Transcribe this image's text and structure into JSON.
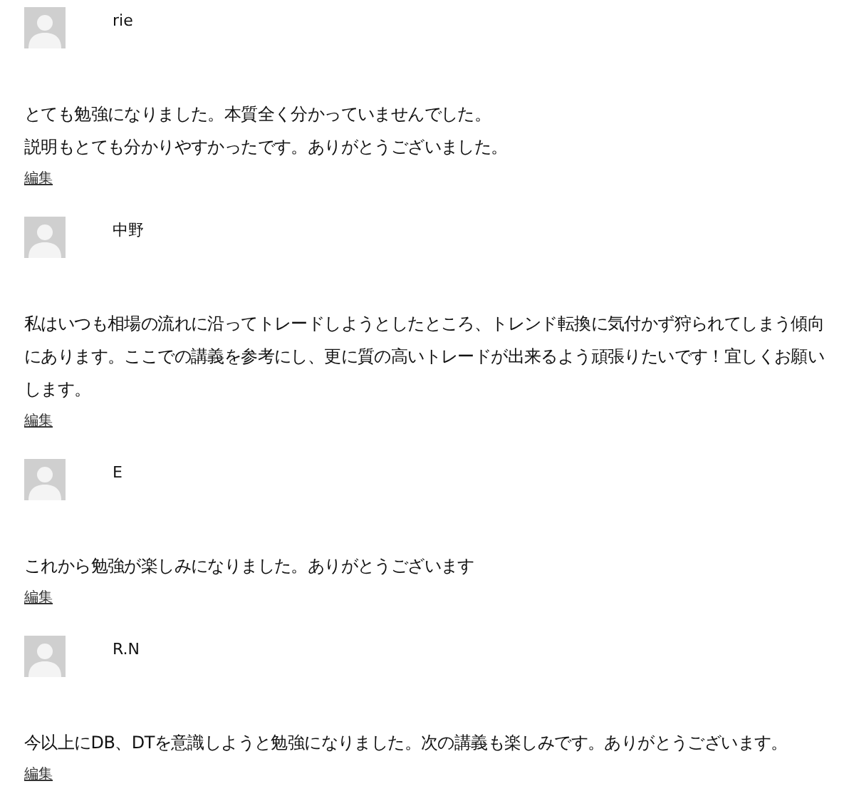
{
  "comments": [
    {
      "author": "rie",
      "paragraphs": [
        "とても勉強になりました。本質全く分かっていませんでした。",
        "説明もとても分かりやすかったです。ありがとうございました。"
      ],
      "edit_link": "編集"
    },
    {
      "author": "中野",
      "paragraphs": [
        "私はいつも相場の流れに沿ってトレードしようとしたところ、トレンド転換に気付かず狩られてしまう傾向にあります。ここでの講義を参考にし、更に質の高いトレードが出来るよう頑張りたいです！宜しくお願いします。"
      ],
      "edit_link": "編集"
    },
    {
      "author": "E",
      "paragraphs": [
        "これから勉強が楽しみになりました。ありがとうございます"
      ],
      "edit_link": "編集"
    },
    {
      "author": "R.N",
      "paragraphs": [
        "今以上にDB、DTを意識しようと勉強になりました。次の講義も楽しみです。ありがとうございます。"
      ],
      "edit_link": "編集"
    }
  ]
}
